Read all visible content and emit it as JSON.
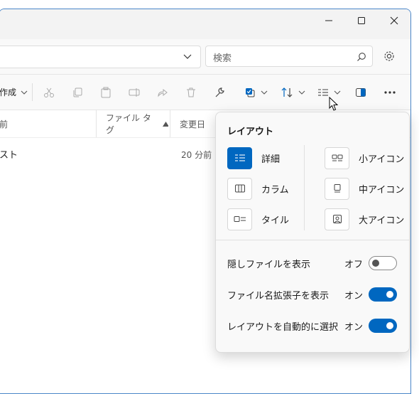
{
  "search": {
    "placeholder": "検索"
  },
  "toolbar": {
    "new_label": "作成"
  },
  "columns": {
    "name": "前",
    "tags": "ファイル タグ",
    "modified": "変更日"
  },
  "rows": [
    {
      "name": "スト",
      "modified": "20 分前"
    }
  ],
  "flyout": {
    "title": "レイアウト",
    "layouts": [
      {
        "label": "詳細",
        "icon": "details-icon",
        "selected": true
      },
      {
        "label": "カラム",
        "icon": "columns-icon",
        "selected": false
      },
      {
        "label": "タイル",
        "icon": "tiles-icon",
        "selected": false
      },
      {
        "label": "小アイコン",
        "icon": "small-icons-icon",
        "selected": false
      },
      {
        "label": "中アイコン",
        "icon": "medium-icons-icon",
        "selected": false
      },
      {
        "label": "大アイコン",
        "icon": "large-icons-icon",
        "selected": false
      }
    ],
    "toggles": [
      {
        "label": "隠しファイルを表示",
        "state": "オフ",
        "on": false
      },
      {
        "label": "ファイル名拡張子を表示",
        "state": "オン",
        "on": true
      },
      {
        "label": "レイアウトを自動的に選択",
        "state": "オン",
        "on": true
      }
    ]
  },
  "colors": {
    "accent": "#0067c0",
    "window_border": "#4a86c8"
  }
}
